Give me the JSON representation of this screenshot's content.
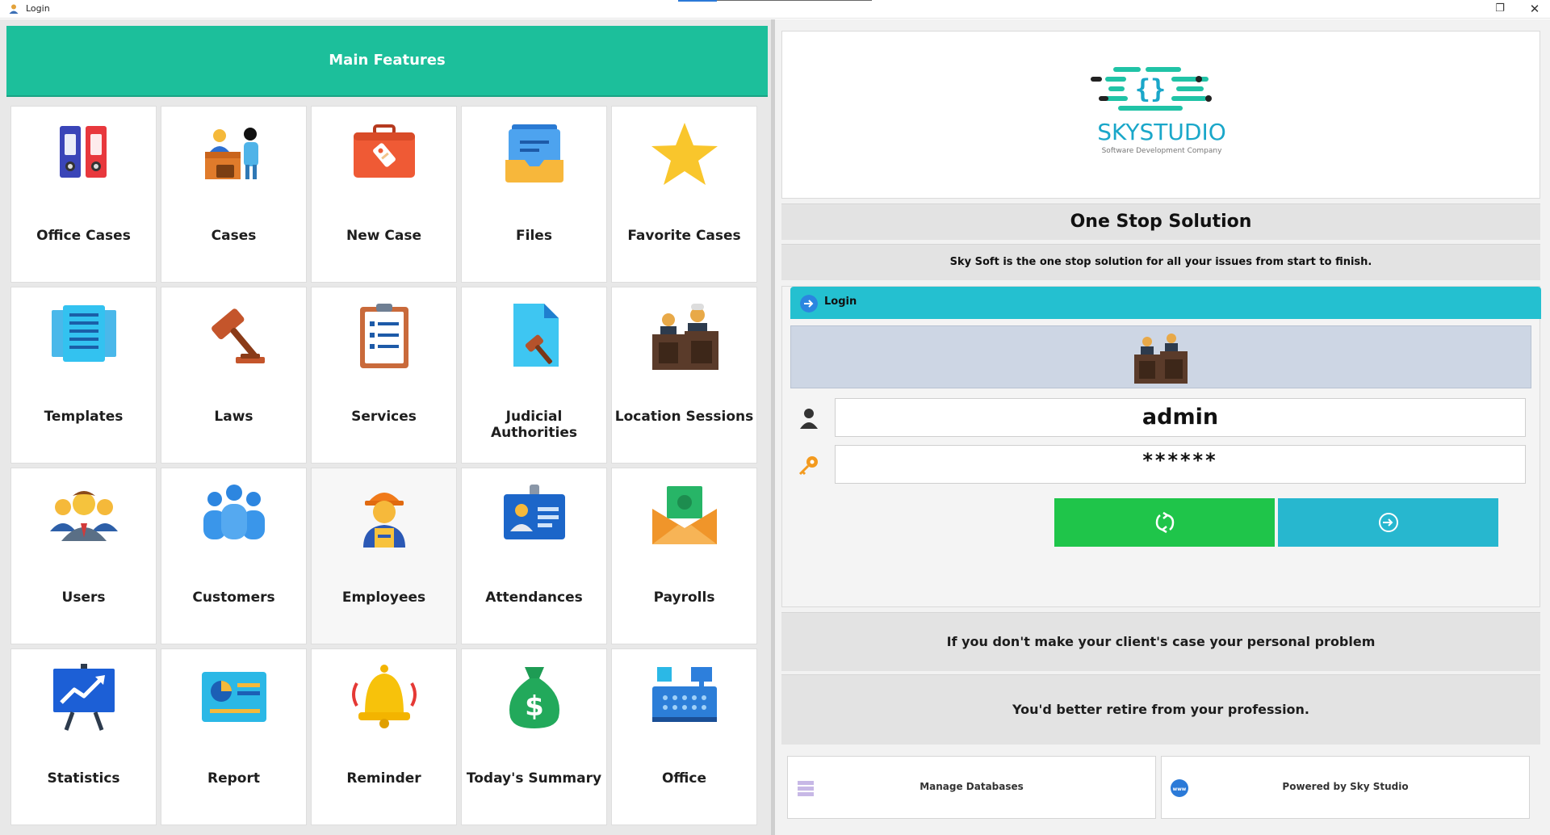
{
  "window": {
    "title": "Login"
  },
  "left": {
    "header": "Main Features",
    "tiles": [
      {
        "label": "Office Cases",
        "icon": "binders-icon"
      },
      {
        "label": "Cases",
        "icon": "client-desk-icon"
      },
      {
        "label": "New Case",
        "icon": "case-bag-icon"
      },
      {
        "label": "Files",
        "icon": "file-tray-icon"
      },
      {
        "label": "Favorite Cases",
        "icon": "star-icon"
      },
      {
        "label": "Templates",
        "icon": "templates-icon"
      },
      {
        "label": "Laws",
        "icon": "gavel-icon"
      },
      {
        "label": "Services",
        "icon": "clipboard-list-icon"
      },
      {
        "label": "Judicial Authorities",
        "icon": "document-gavel-icon"
      },
      {
        "label": "Location Sessions",
        "icon": "judges-icon"
      },
      {
        "label": "Users",
        "icon": "users-group-icon"
      },
      {
        "label": "Customers",
        "icon": "customers-icon"
      },
      {
        "label": "Employees",
        "icon": "worker-icon"
      },
      {
        "label": "Attendances",
        "icon": "id-badge-icon"
      },
      {
        "label": "Payrolls",
        "icon": "money-envelope-icon"
      },
      {
        "label": "Statistics",
        "icon": "chart-board-icon"
      },
      {
        "label": "Report",
        "icon": "report-icon"
      },
      {
        "label": "Reminder",
        "icon": "bell-icon"
      },
      {
        "label": "Today's Summary",
        "icon": "money-bag-icon"
      },
      {
        "label": "Office",
        "icon": "office-desk-icon"
      }
    ]
  },
  "right": {
    "logo": {
      "name": "SKYSTUDIO",
      "tagline": "Software Development Company"
    },
    "headline": "One Stop Solution",
    "subline": "Sky Soft is the one stop solution for all your issues from start to finish.",
    "login": {
      "tab_label": "Login",
      "username_value": "admin",
      "password_value": "******"
    },
    "quote_line1": "If you don't make your client's case your personal problem",
    "quote_line2": "You'd better retire from your profession.",
    "footer": {
      "manage_db": "Manage Databases",
      "powered_by": "Powered by Sky Studio"
    }
  },
  "colors": {
    "header_teal": "#1cbf9b",
    "login_tab": "#24c0d0",
    "refresh_green": "#1fc54a",
    "enter_cyan": "#27b7cf"
  }
}
